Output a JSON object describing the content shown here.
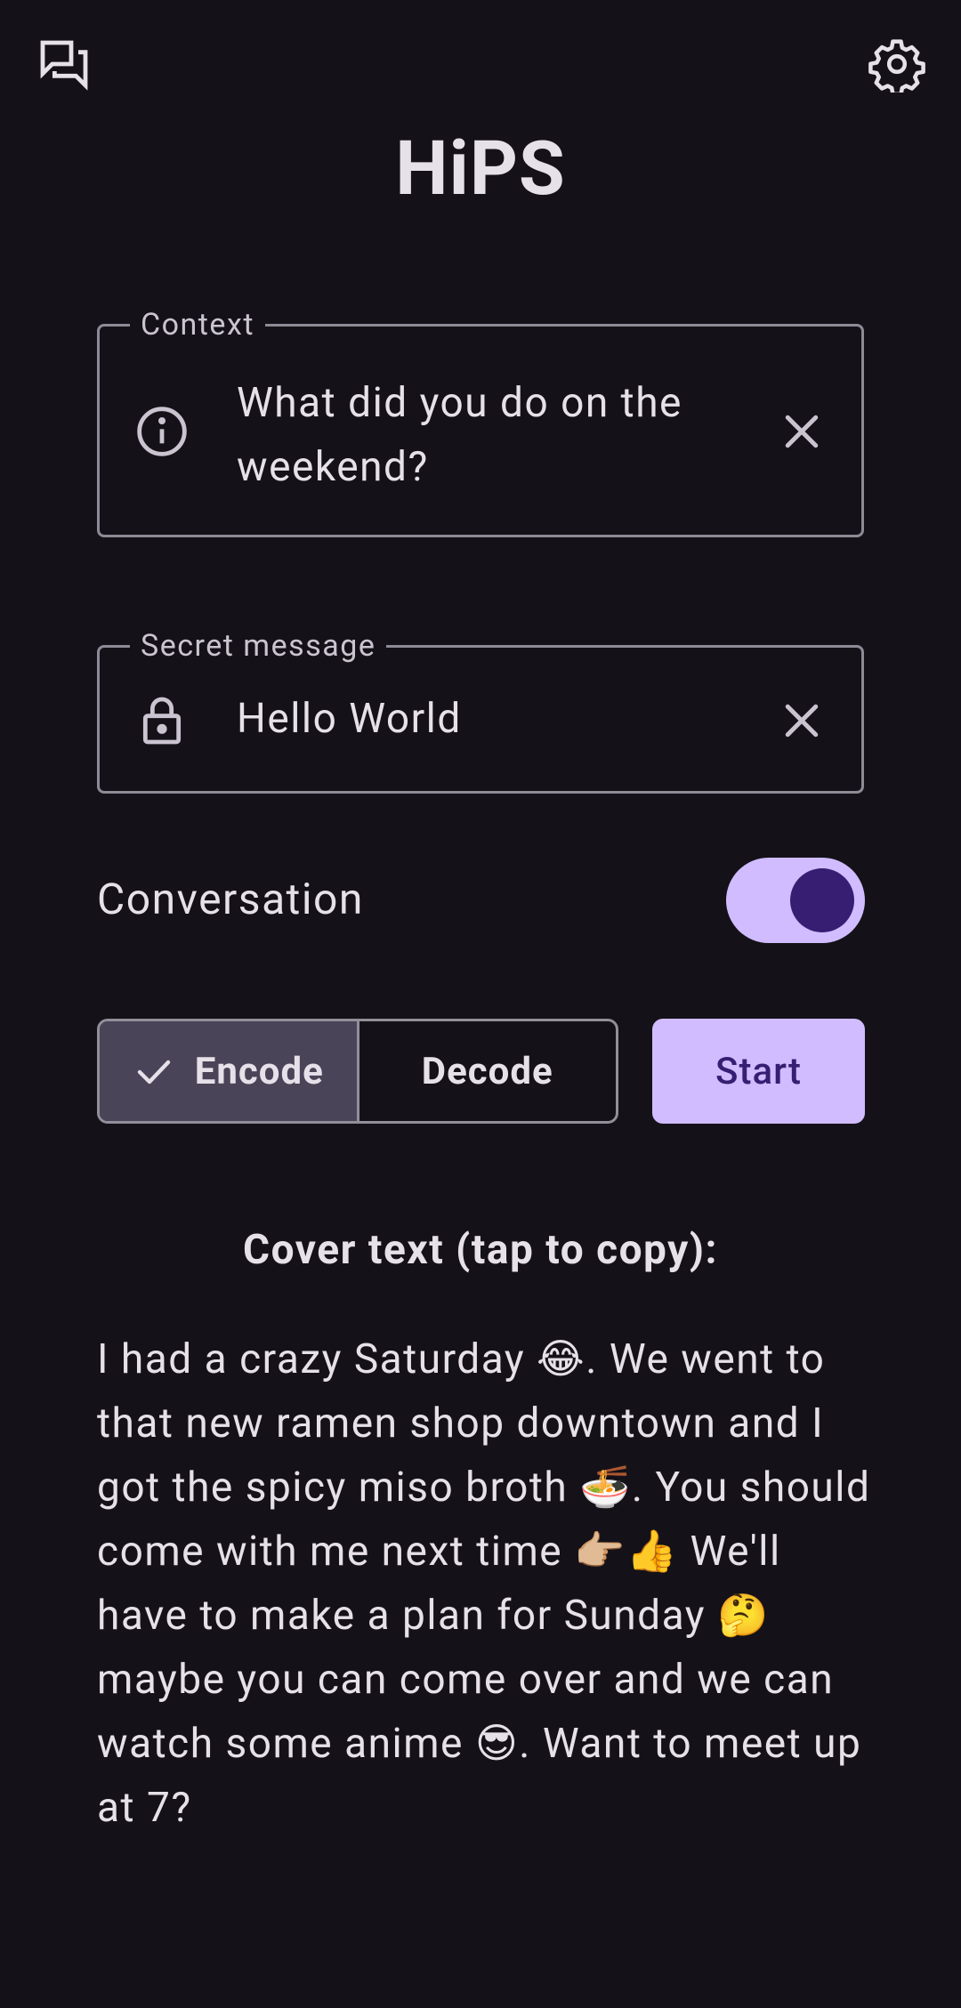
{
  "app": {
    "title": "HiPS"
  },
  "icons": {
    "top_left": "forum-icon",
    "top_right": "gear-icon",
    "context_lead": "info-icon",
    "secret_lead": "lock-icon",
    "clear": "close-icon",
    "selected_check": "check-icon"
  },
  "context": {
    "label": "Context",
    "value": "What did you do on the weekend?"
  },
  "secret": {
    "label": "Secret message",
    "value": "Hello World"
  },
  "conversation": {
    "label": "Conversation",
    "enabled": true
  },
  "mode": {
    "encode_label": "Encode",
    "decode_label": "Decode",
    "selected": "Encode"
  },
  "start": {
    "label": "Start"
  },
  "cover": {
    "title": "Cover text (tap to copy):",
    "text": "I had a crazy Saturday 😂. We went to that new ramen shop downtown and I got the spicy miso broth 🍜. You should come with me next time 👉🏼👍 We'll have to make a plan for Sunday 🤔 maybe you can come over and we can watch some anime 😎. Want to meet up at 7?"
  },
  "colors": {
    "background": "#141218",
    "primary": "#D0BCFF",
    "on_primary": "#381E72",
    "selected_segment": "#4A4458",
    "outline": "#938F99"
  }
}
